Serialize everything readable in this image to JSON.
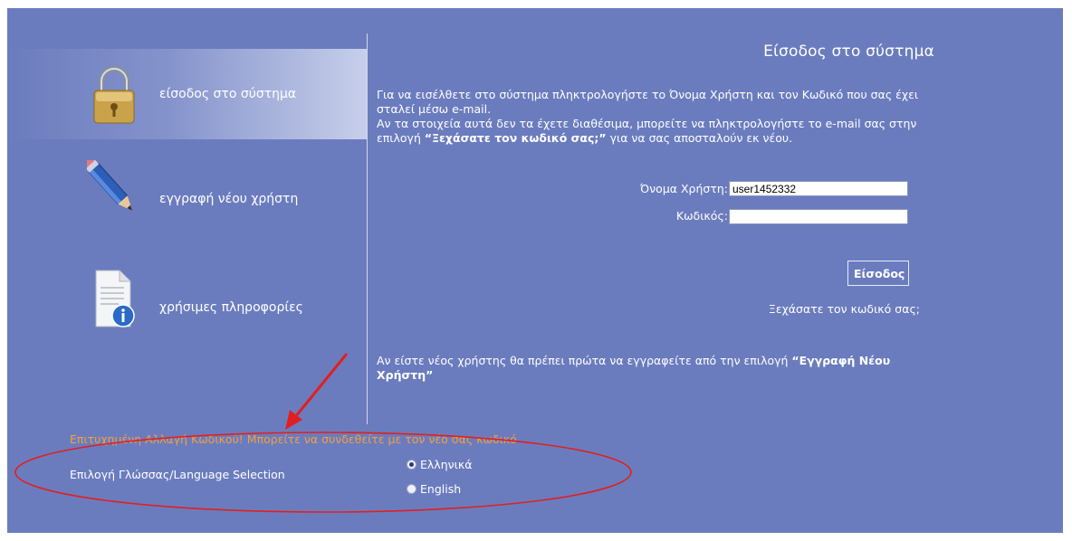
{
  "sidebar": {
    "items": [
      {
        "label": "είσοδος στο σύστημα",
        "icon": "padlock-icon",
        "active": true
      },
      {
        "label": "εγγραφή νέου χρήστη",
        "icon": "pencil-icon",
        "active": false
      },
      {
        "label": "χρήσιμες πληροφορίες",
        "icon": "info-document-icon",
        "active": false
      }
    ]
  },
  "login": {
    "title": "Είσοδος στο σύστημα",
    "intro_part1": "Για να εισέλθετε στο σύστημα πληκτρολογήστε το Όνομα Χρήστη και τον Κωδικό που σας έχει σταλεί μέσω e-mail.",
    "intro_part2": "Αν τα στοιχεία αυτά δεν τα έχετε διαθέσιμα, μπορείτε να πληκτρολογήστε το e-mail σας στην επιλογή ",
    "intro_bold": "“Ξεχάσατε τον κωδικό σας;”",
    "intro_part3": " για να σας αποσταλούν εκ νέου.",
    "username_label": "Όνομα Χρήστη:",
    "username_value": "user1452332",
    "password_label": "Κωδικός:",
    "password_value": "",
    "submit_label": "Είσοδος",
    "forgot_label": "Ξεχάσατε τον κωδικό σας;",
    "new_user_text": "Αν είστε νέος χρήστης θα πρέπει πρώτα να εγγραφείτε από την επιλογή ",
    "new_user_bold": "“Εγγραφή Νέου Χρήστη”"
  },
  "status": {
    "success_message": "Επιτυχημένη Αλλαγή Κωδικού! Μπορείτε να συνδεθείτε με τον νέο σας κωδικό",
    "success_color": "#f0a040"
  },
  "language": {
    "label": "Επιλογή Γλώσσας/Language Selection",
    "options": [
      {
        "label": "Ελληνικά",
        "selected": true
      },
      {
        "label": "English",
        "selected": false
      }
    ]
  },
  "colors": {
    "panel_background": "#6b7cbe",
    "annotation_red": "#e02020"
  }
}
